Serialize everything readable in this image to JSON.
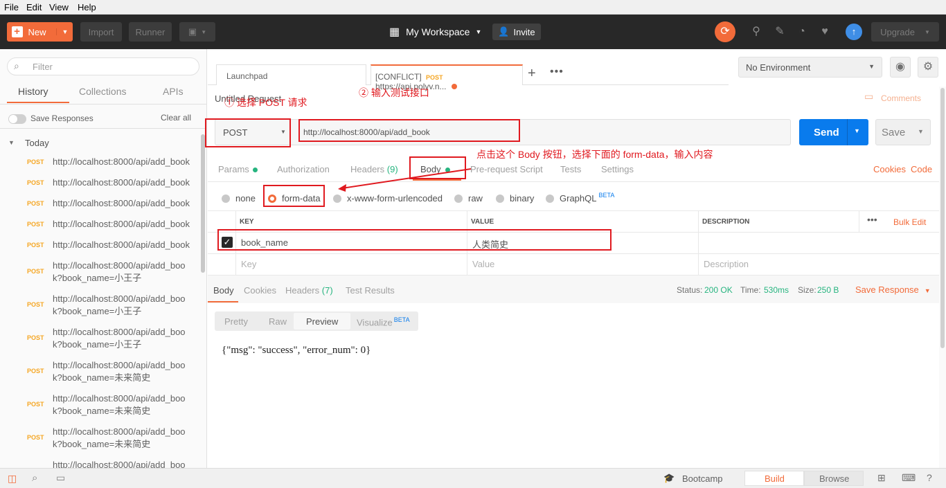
{
  "menu": [
    "File",
    "Edit",
    "View",
    "Help"
  ],
  "header": {
    "new_label": "New",
    "import_label": "Import",
    "runner_label": "Runner",
    "workspace_label": "My Workspace",
    "invite_label": "Invite",
    "upgrade_label": "Upgrade"
  },
  "sidebar": {
    "filter_placeholder": "Filter",
    "tabs": [
      "History",
      "Collections",
      "APIs"
    ],
    "save_responses_label": "Save Responses",
    "clear_all_label": "Clear all",
    "group_label": "Today",
    "items": [
      {
        "method": "POST",
        "url": "http://localhost:8000/api/add_book"
      },
      {
        "method": "POST",
        "url": "http://localhost:8000/api/add_book"
      },
      {
        "method": "POST",
        "url": "http://localhost:8000/api/add_book"
      },
      {
        "method": "POST",
        "url": "http://localhost:8000/api/add_book"
      },
      {
        "method": "POST",
        "url": "http://localhost:8000/api/add_book"
      },
      {
        "method": "POST",
        "url": "http://localhost:8000/api/add_boo k?book_name=小王子"
      },
      {
        "method": "POST",
        "url": "http://localhost:8000/api/add_boo k?book_name=小王子"
      },
      {
        "method": "POST",
        "url": "http://localhost:8000/api/add_boo k?book_name=小王子"
      },
      {
        "method": "POST",
        "url": "http://localhost:8000/api/add_boo k?book_name=未来简史"
      },
      {
        "method": "POST",
        "url": "http://localhost:8000/api/add_boo k?book_name=未来简史"
      },
      {
        "method": "POST",
        "url": "http://localhost:8000/api/add_boo k?book_name=未来简史"
      },
      {
        "method": "",
        "url": "http://localhost:8000/api/add_boo"
      }
    ]
  },
  "tabs": {
    "launchpad": "Launchpad",
    "conflict_prefix": "[CONFLICT]",
    "conflict_method": "POST",
    "conflict_url": "https://api.polyv.n..."
  },
  "environment": "No Environment",
  "request": {
    "title": "Untitled Request",
    "comments_label": "Comments",
    "method": "POST",
    "url": "http://localhost:8000/api/add_book",
    "send_label": "Send",
    "save_label": "Save",
    "subtabs": {
      "params": "Params",
      "authorization": "Authorization",
      "headers": "Headers",
      "headers_count": "(9)",
      "body": "Body",
      "prerequest": "Pre-request Script",
      "tests": "Tests",
      "settings": "Settings"
    },
    "cookies_label": "Cookies",
    "code_label": "Code",
    "body_types": [
      "none",
      "form-data",
      "x-www-form-urlencoded",
      "raw",
      "binary",
      "GraphQL"
    ],
    "beta_label": "BETA",
    "table": {
      "headers": [
        "KEY",
        "VALUE",
        "DESCRIPTION"
      ],
      "bulk_edit": "Bulk Edit",
      "row": {
        "key": "book_name",
        "value": "人类简史"
      },
      "placeholders": {
        "key": "Key",
        "value": "Value",
        "description": "Description"
      }
    }
  },
  "annotations": {
    "step1": "① 选择 POST 请求",
    "step2": "② 输入测试接口",
    "step3": "点击这个 Body 按钮，选择下面的 form-data，输入内容"
  },
  "response": {
    "tabs": {
      "body": "Body",
      "cookies": "Cookies",
      "headers": "Headers",
      "headers_count": "(7)",
      "test_results": "Test Results"
    },
    "status_label": "Status:",
    "status_value": "200 OK",
    "time_label": "Time:",
    "time_value": "530ms",
    "size_label": "Size:",
    "size_value": "250 B",
    "save_response": "Save Response",
    "view_modes": [
      "Pretty",
      "Raw",
      "Preview",
      "Visualize"
    ],
    "body_text": "{\"msg\": \"success\", \"error_num\": 0}"
  },
  "bottombar": {
    "bootcamp": "Bootcamp",
    "build": "Build",
    "browse": "Browse"
  },
  "colors": {
    "accent": "#f26b3a",
    "send_blue": "#097bed",
    "annotation_red": "#e0191f",
    "status_green": "#26b47f",
    "post_orange": "#f5a623"
  }
}
